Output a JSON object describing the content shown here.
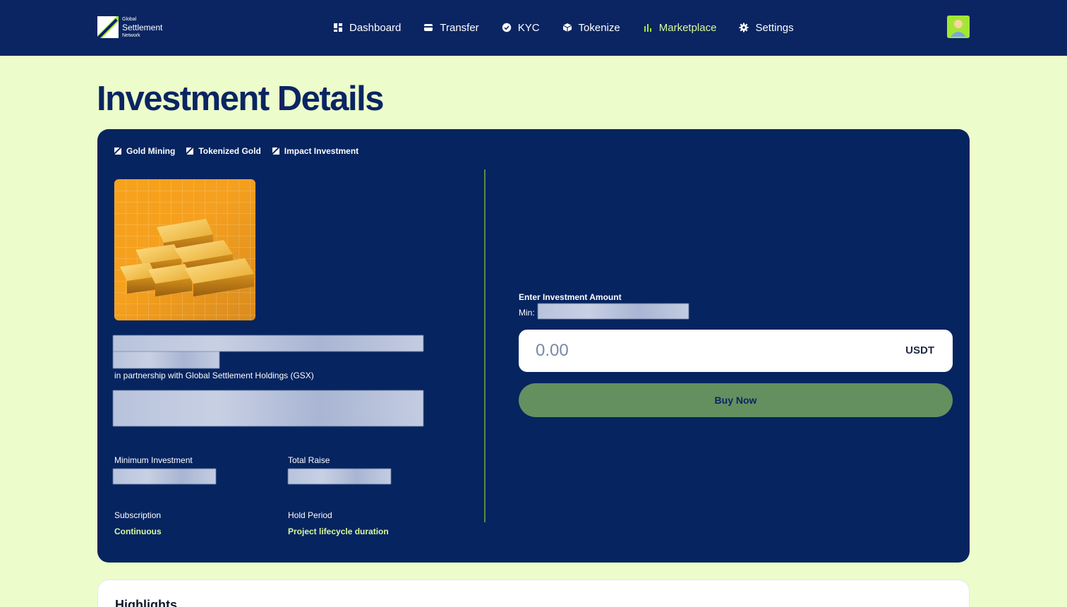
{
  "header": {
    "logo": {
      "small_top": "Global",
      "main": "Settlement",
      "small_bottom": "Network"
    },
    "nav": [
      {
        "label": "Dashboard",
        "icon": "dashboard-icon"
      },
      {
        "label": "Transfer",
        "icon": "card-icon"
      },
      {
        "label": "KYC",
        "icon": "verified-badge-icon"
      },
      {
        "label": "Tokenize",
        "icon": "cube-icon"
      },
      {
        "label": "Marketplace",
        "icon": "bar-chart-icon",
        "active": true
      },
      {
        "label": "Settings",
        "icon": "gear-icon"
      }
    ],
    "avatar_icon": "user-avatar-icon"
  },
  "page": {
    "title": "Investment Details"
  },
  "details": {
    "tags": [
      "Gold Mining",
      "Tokenized Gold",
      "Impact Investment"
    ],
    "image_icon": "gold-bars-icon",
    "partner_text": "in partnership with Global Settlement Holdings (GSX)",
    "stats": {
      "min_investment_label": "Minimum Investment",
      "total_raise_label": "Total Raise",
      "subscription_label": "Subscription",
      "subscription_value": "Continuous",
      "hold_period_label": "Hold Period",
      "hold_period_value": "Project lifecycle duration"
    }
  },
  "invest": {
    "label": "Enter Investment Amount",
    "min_label": "Min:",
    "amount_placeholder": "0.00",
    "currency": "USDT",
    "buy_label": "Buy Now"
  },
  "highlights": {
    "title": "Highlights"
  },
  "colors": {
    "navy": "#0a2562",
    "lime": "#d9f99d",
    "background": "#ecfccb",
    "buy_button": "#64905f"
  }
}
